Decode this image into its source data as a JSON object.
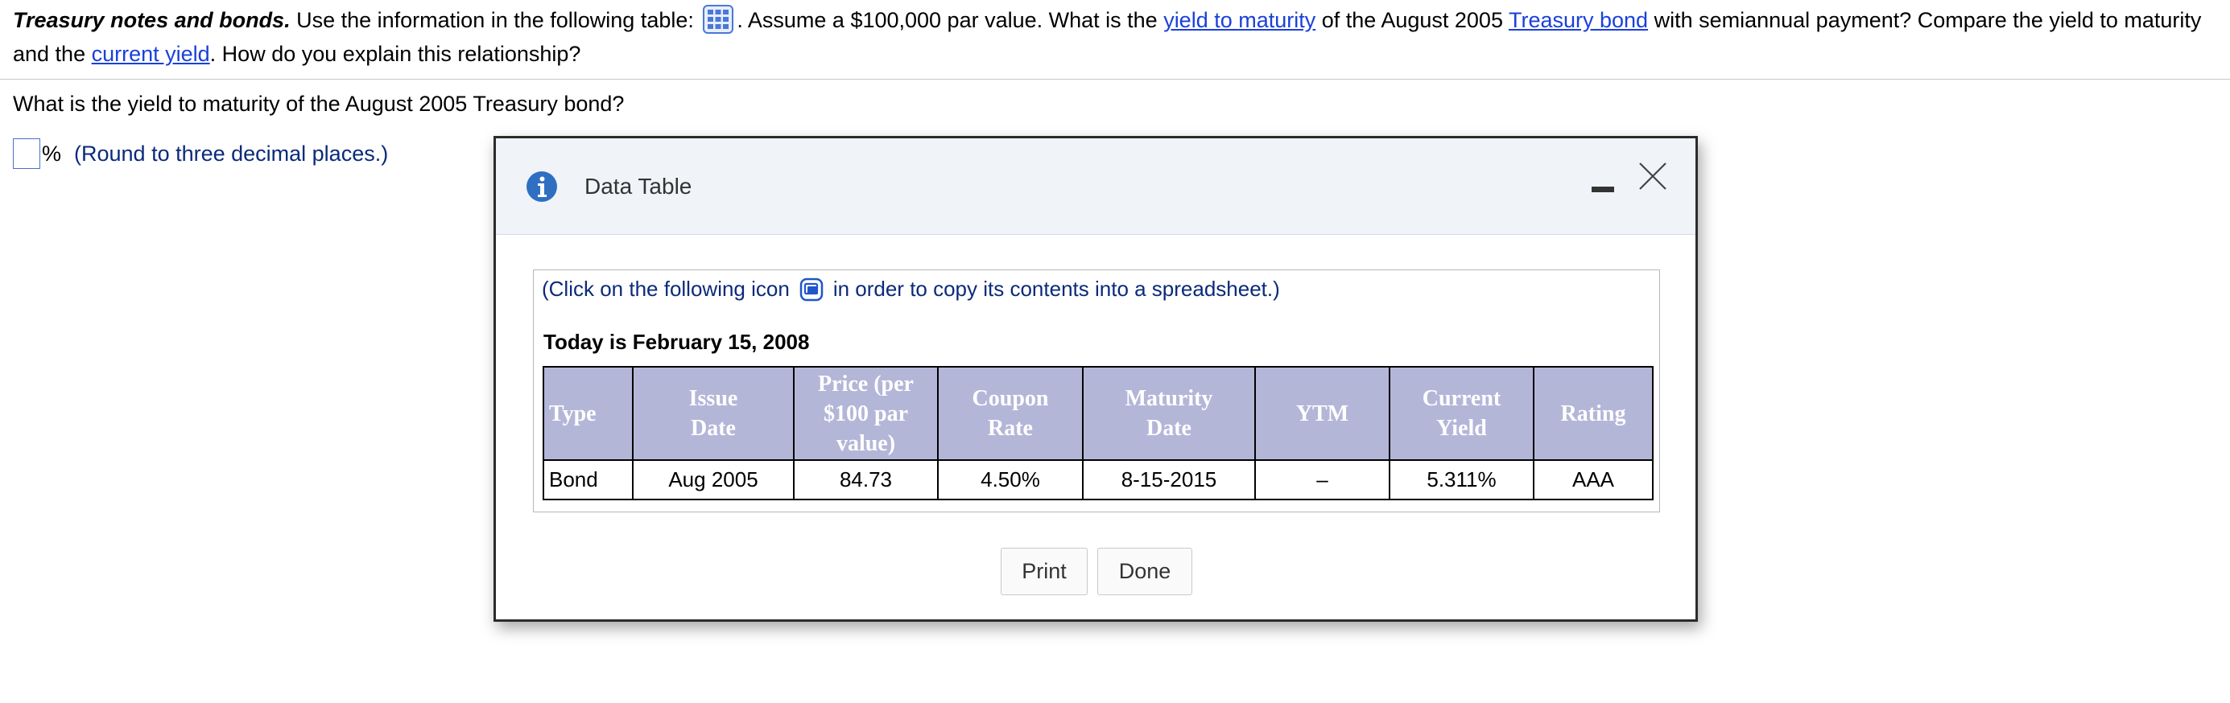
{
  "problem": {
    "title": "Treasury notes and bonds.",
    "t1": " Use the information in the following table: ",
    "t2": ". Assume a $100,000 par value. What is the ",
    "link_ytm": "yield to maturity",
    "t3": " of the August 2005 ",
    "link_bond": "Treasury bond",
    "t4": " with semiannual payment? Compare the yield to maturity and the ",
    "link_cy": "current yield",
    "t5": ". How do you explain this relationship?"
  },
  "question": "What is the yield to maturity of the August 2005 Treasury bond?",
  "answer": {
    "value": "",
    "unit": "%",
    "hint": "(Round to three decimal places.)"
  },
  "dialog": {
    "title": "Data Table",
    "copy_pre": "(Click on the following icon",
    "copy_post": "in order to copy its contents into a spreadsheet.)",
    "today": "Today is February 15, 2008",
    "headers": [
      "Type",
      "Issue\nDate",
      "Price (per\n$100 par\nvalue)",
      "Coupon\nRate",
      "Maturity\nDate",
      "YTM",
      "Current\nYield",
      "Rating"
    ],
    "rows": [
      [
        "Bond",
        "Aug 2005",
        "84.73",
        "4.50%",
        "8-15-2015",
        "–",
        "5.311%",
        "AAA"
      ]
    ],
    "print_label": "Print",
    "done_label": "Done"
  },
  "colors": {
    "header_bg": "#b4b6d8",
    "link": "#1a40d9",
    "info_icon": "#2f6fc2",
    "dialog_header_bg": "#f0f4f9"
  },
  "icons": [
    "table-icon",
    "info-icon",
    "minimize-icon",
    "close-icon",
    "copy-spreadsheet-icon"
  ]
}
